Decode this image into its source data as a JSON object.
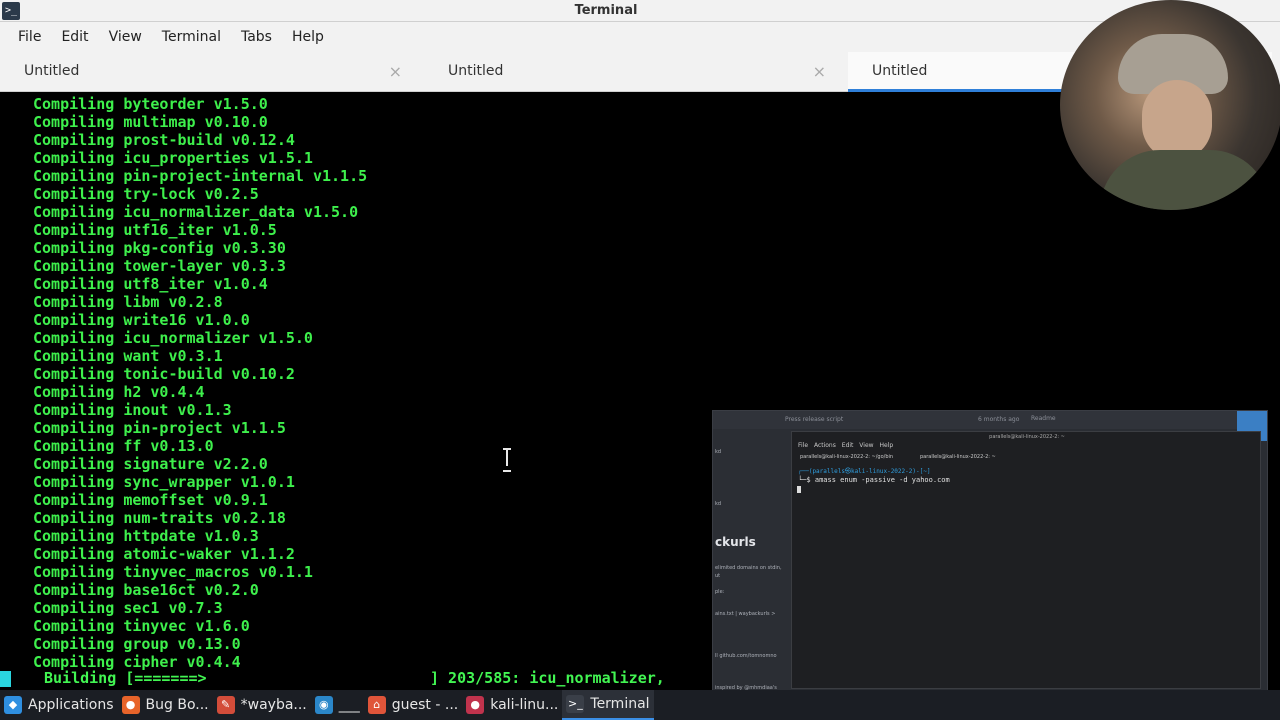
{
  "window": {
    "title": "Terminal"
  },
  "menu": [
    "File",
    "Edit",
    "View",
    "Terminal",
    "Tabs",
    "Help"
  ],
  "tabs": [
    {
      "label": "Untitled",
      "active": false
    },
    {
      "label": "Untitled",
      "active": false
    },
    {
      "label": "Untitled",
      "active": true
    }
  ],
  "terminal": {
    "lines": [
      {
        "verb": "Compiling",
        "pkg": "byteorder v1.5.0"
      },
      {
        "verb": "Compiling",
        "pkg": "multimap v0.10.0"
      },
      {
        "verb": "Compiling",
        "pkg": "prost-build v0.12.4"
      },
      {
        "verb": "Compiling",
        "pkg": "icu_properties v1.5.1"
      },
      {
        "verb": "Compiling",
        "pkg": "pin-project-internal v1.1.5"
      },
      {
        "verb": "Compiling",
        "pkg": "try-lock v0.2.5"
      },
      {
        "verb": "Compiling",
        "pkg": "icu_normalizer_data v1.5.0"
      },
      {
        "verb": "Compiling",
        "pkg": "utf16_iter v1.0.5"
      },
      {
        "verb": "Compiling",
        "pkg": "pkg-config v0.3.30"
      },
      {
        "verb": "Compiling",
        "pkg": "tower-layer v0.3.3"
      },
      {
        "verb": "Compiling",
        "pkg": "utf8_iter v1.0.4"
      },
      {
        "verb": "Compiling",
        "pkg": "libm v0.2.8"
      },
      {
        "verb": "Compiling",
        "pkg": "write16 v1.0.0"
      },
      {
        "verb": "Compiling",
        "pkg": "icu_normalizer v1.5.0"
      },
      {
        "verb": "Compiling",
        "pkg": "want v0.3.1"
      },
      {
        "verb": "Compiling",
        "pkg": "tonic-build v0.10.2"
      },
      {
        "verb": "Compiling",
        "pkg": "h2 v0.4.4"
      },
      {
        "verb": "Compiling",
        "pkg": "inout v0.1.3"
      },
      {
        "verb": "Compiling",
        "pkg": "pin-project v1.1.5"
      },
      {
        "verb": "Compiling",
        "pkg": "ff v0.13.0"
      },
      {
        "verb": "Compiling",
        "pkg": "signature v2.2.0"
      },
      {
        "verb": "Compiling",
        "pkg": "sync_wrapper v1.0.1"
      },
      {
        "verb": "Compiling",
        "pkg": "memoffset v0.9.1"
      },
      {
        "verb": "Compiling",
        "pkg": "num-traits v0.2.18"
      },
      {
        "verb": "Compiling",
        "pkg": "httpdate v1.0.3"
      },
      {
        "verb": "Compiling",
        "pkg": "atomic-waker v1.1.2"
      },
      {
        "verb": "Compiling",
        "pkg": "tinyvec_macros v0.1.1"
      },
      {
        "verb": "Compiling",
        "pkg": "base16ct v0.2.0"
      },
      {
        "verb": "Compiling",
        "pkg": "sec1 v0.7.3"
      },
      {
        "verb": "Compiling",
        "pkg": "tinyvec v1.6.0"
      },
      {
        "verb": "Compiling",
        "pkg": "group v0.13.0"
      },
      {
        "verb": "Compiling",
        "pkg": "cipher v0.4.4"
      }
    ],
    "build_label": "Building [=======>",
    "build_progress": "] 203/585: icu_normalizer,",
    "text_color": "#42f552"
  },
  "second_screen": {
    "hint": "Press release script",
    "ago": "6 months ago",
    "readme": "Readme",
    "heading": "ckurls",
    "small_lines": [
      "kd",
      "kd",
      "elimited domains on stdin,",
      "ut",
      "ple:",
      "ains.txt | waybackurls >",
      "ll github.com/tomnomno",
      "inspired by @mhmdiaa's"
    ],
    "mini_title": "parallels@kali-linux-2022-2: ~",
    "mini_menu": "File Actions Edit View Help",
    "mini_tab1": "parallels@kali-linux-2022-2: ~/go/bin",
    "mini_tab2": "parallels@kali-linux-2022-2: ~",
    "mini_prompt": "┌──(parallels㉿kali-linux-2022-2)-[~]",
    "mini_cmd": "└─$ amass enum -passive -d yahoo.com"
  },
  "taskbar": [
    {
      "label": "Applications",
      "icon": "kali-dragon-icon",
      "color": "#2f8fe0"
    },
    {
      "label": "Bug Bo...",
      "icon": "firefox-icon",
      "color": "#e8642a"
    },
    {
      "label": "*wayba...",
      "icon": "text-editor-icon",
      "color": "#d34d3a"
    },
    {
      "label": "___",
      "icon": "kali-app-icon",
      "color": "#2b87c9"
    },
    {
      "label": "guest - ...",
      "icon": "home-icon",
      "color": "#e0553a"
    },
    {
      "label": "kali-linu...",
      "icon": "record-icon",
      "color": "#c0334d"
    },
    {
      "label": "Terminal",
      "icon": "terminal-icon",
      "color": "#3a3f48"
    }
  ]
}
